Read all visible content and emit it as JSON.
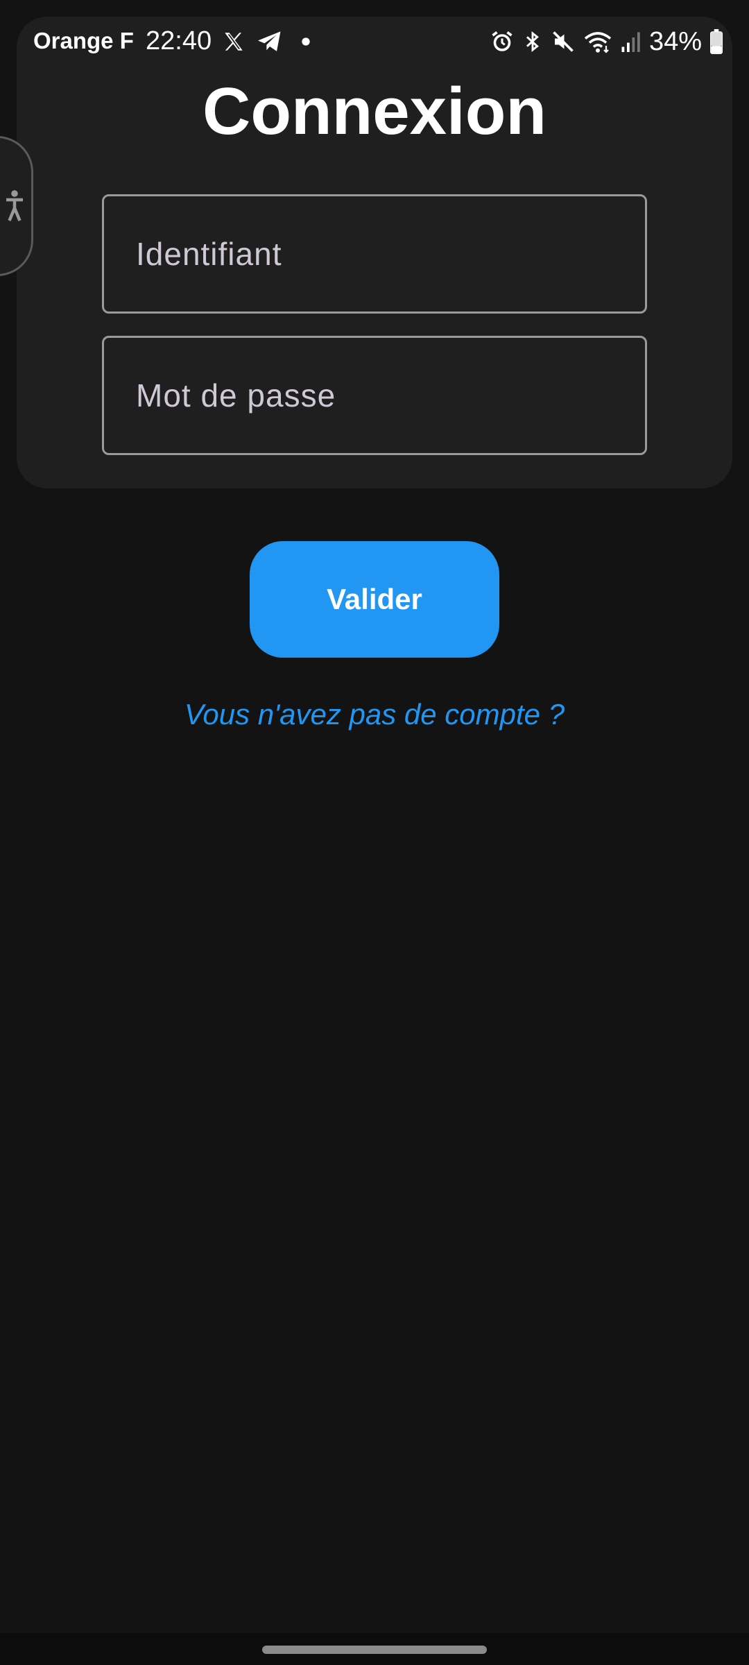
{
  "status_bar": {
    "carrier": "Orange F",
    "time": "22:40",
    "notification_icons": [
      "x-icon",
      "telegram-icon",
      "dot-icon"
    ],
    "system_icons": [
      "alarm-icon",
      "bluetooth-icon",
      "mute-icon",
      "wifi-icon",
      "signal-icon"
    ],
    "battery_percent": "34%",
    "battery_level": 0.34
  },
  "login": {
    "title": "Connexion",
    "username_placeholder": "Identifiant",
    "username_value": "",
    "password_placeholder": "Mot de passe",
    "password_value": "",
    "submit_label": "Valider",
    "signup_link": "Vous n'avez pas de compte ?"
  },
  "colors": {
    "background": "#131313",
    "card": "#1f1f1f",
    "accent": "#2196f3",
    "field_border": "#9a9a9a"
  }
}
